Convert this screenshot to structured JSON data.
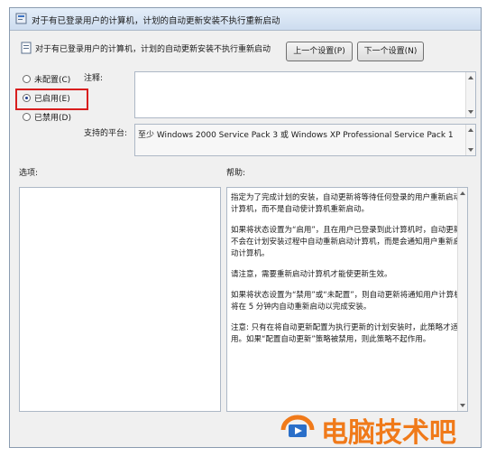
{
  "window": {
    "title": "对于有已登录用户的计算机，计划的自动更新安装不执行重新启动"
  },
  "header": {
    "policy_name": "对于有已登录用户的计算机，计划的自动更新安装不执行重新启动",
    "prev_button": "上一个设置(P)",
    "next_button": "下一个设置(N)"
  },
  "state": {
    "options": [
      {
        "label": "未配置(C)",
        "selected": false
      },
      {
        "label": "已启用(E)",
        "selected": true
      },
      {
        "label": "已禁用(D)",
        "selected": false
      }
    ]
  },
  "comment": {
    "label": "注释:",
    "value": ""
  },
  "supported": {
    "label": "支持的平台:",
    "value": "至少 Windows 2000 Service Pack 3 或 Windows XP Professional Service Pack 1"
  },
  "options_panel": {
    "label": "选项:"
  },
  "help_panel": {
    "label": "帮助:",
    "paragraphs": [
      "指定为了完成计划的安装，自动更新将等待任何登录的用户重新启动计算机，而不是自动使计算机重新启动。",
      "如果将状态设置为“启用”，且在用户已登录到此计算机时，自动更新不会在计划安装过程中自动重新启动计算机，而是会通知用户重新启动计算机。",
      "请注意，需要重新启动计算机才能使更新生效。",
      "如果将状态设置为“禁用”或“未配置”，则自动更新将通知用户计算机将在 5 分钟内自动重新启动以完成安装。",
      "注意: 只有在将自动更新配置为执行更新的计划安装时，此策略才适用。如果“配置自动更新”策略被禁用，则此策略不起作用。"
    ]
  },
  "watermark": {
    "text": "电脑技术吧",
    "color": "#f07a1a"
  },
  "colors": {
    "highlight": "#d81e1e",
    "titlebar": "#cddcef"
  }
}
